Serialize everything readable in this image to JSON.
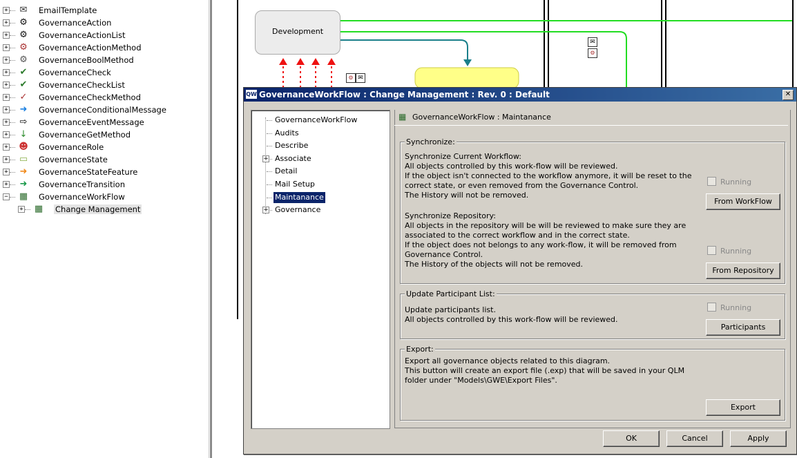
{
  "left_tree": {
    "items": [
      {
        "label": "EmailTemplate",
        "icon": "email-icon"
      },
      {
        "label": "GovernanceAction",
        "icon": "gear-icon"
      },
      {
        "label": "GovernanceActionList",
        "icon": "gear-list-icon"
      },
      {
        "label": "GovernanceActionMethod",
        "icon": "gear-method-icon"
      },
      {
        "label": "GovernanceBoolMethod",
        "icon": "bool-method-icon"
      },
      {
        "label": "GovernanceCheck",
        "icon": "checkmark-icon"
      },
      {
        "label": "GovernanceCheckList",
        "icon": "check-list-icon"
      },
      {
        "label": "GovernanceCheckMethod",
        "icon": "check-method-icon"
      },
      {
        "label": "GovernanceConditionalMessage",
        "icon": "blue-arrow-icon"
      },
      {
        "label": "GovernanceEventMessage",
        "icon": "outline-arrow-icon"
      },
      {
        "label": "GovernanceGetMethod",
        "icon": "down-arrow-icon"
      },
      {
        "label": "GovernanceRole",
        "icon": "role-icon"
      },
      {
        "label": "GovernanceState",
        "icon": "state-icon"
      },
      {
        "label": "GovernanceStateFeature",
        "icon": "orange-arrow-icon"
      },
      {
        "label": "GovernanceTransition",
        "icon": "green-arrow-icon"
      },
      {
        "label": "GovernanceWorkFlow",
        "icon": "workflow-icon"
      }
    ],
    "child": {
      "label": "Change Management",
      "icon": "workflow-icon"
    }
  },
  "diagram": {
    "state_development": "Development"
  },
  "dialog": {
    "title": "GovernanceWorkFlow : Change Management : Rev. 0  : Default",
    "app_icon_text": "QW",
    "close": "✕",
    "nav": [
      {
        "label": "GovernanceWorkFlow"
      },
      {
        "label": "Audits"
      },
      {
        "label": "Describe"
      },
      {
        "label": "Associate",
        "expand": "+"
      },
      {
        "label": "Detail"
      },
      {
        "label": "Mail Setup"
      },
      {
        "label": "Maintanance"
      },
      {
        "label": "Governance",
        "expand": "+"
      }
    ],
    "header": "GovernanceWorkFlow : Maintanance",
    "synchronize": {
      "caption": "Synchronize:",
      "workflow_text": "Synchronize Current Workflow:\nAll objects controlled by this work-flow will be reviewed.\nIf the object isn't connected to the workflow anymore, it will be reset to the\ncorrect state, or even removed from the Governance Control.\nThe History will not be removed.",
      "workflow_running": "Running",
      "workflow_button": "From WorkFlow",
      "repo_text": "Synchronize Repository:\nAll objects in the repository will be will be reviewed to make sure they are\nassociated to the correct workflow and in the correct state.\nIf the object does not belongs to any work-flow, it will be removed from\nGovernance Control.\nThe History of the objects will not be removed.",
      "repo_running": "Running",
      "repo_button": "From Repository"
    },
    "participants": {
      "caption": "Update Participant List:",
      "text": "Update participants list.\nAll objects controlled by this work-flow will be reviewed.",
      "running": "Running",
      "button": "Participants"
    },
    "export": {
      "caption": "Export:",
      "text": "Export all governance objects related to this diagram.\nThis button will create an export file (.exp) that will be saved in your QLM\nfolder under \"Models\\GWE\\Export Files\".",
      "button": "Export"
    },
    "footer": {
      "ok": "OK",
      "cancel": "Cancel",
      "apply": "Apply"
    }
  }
}
